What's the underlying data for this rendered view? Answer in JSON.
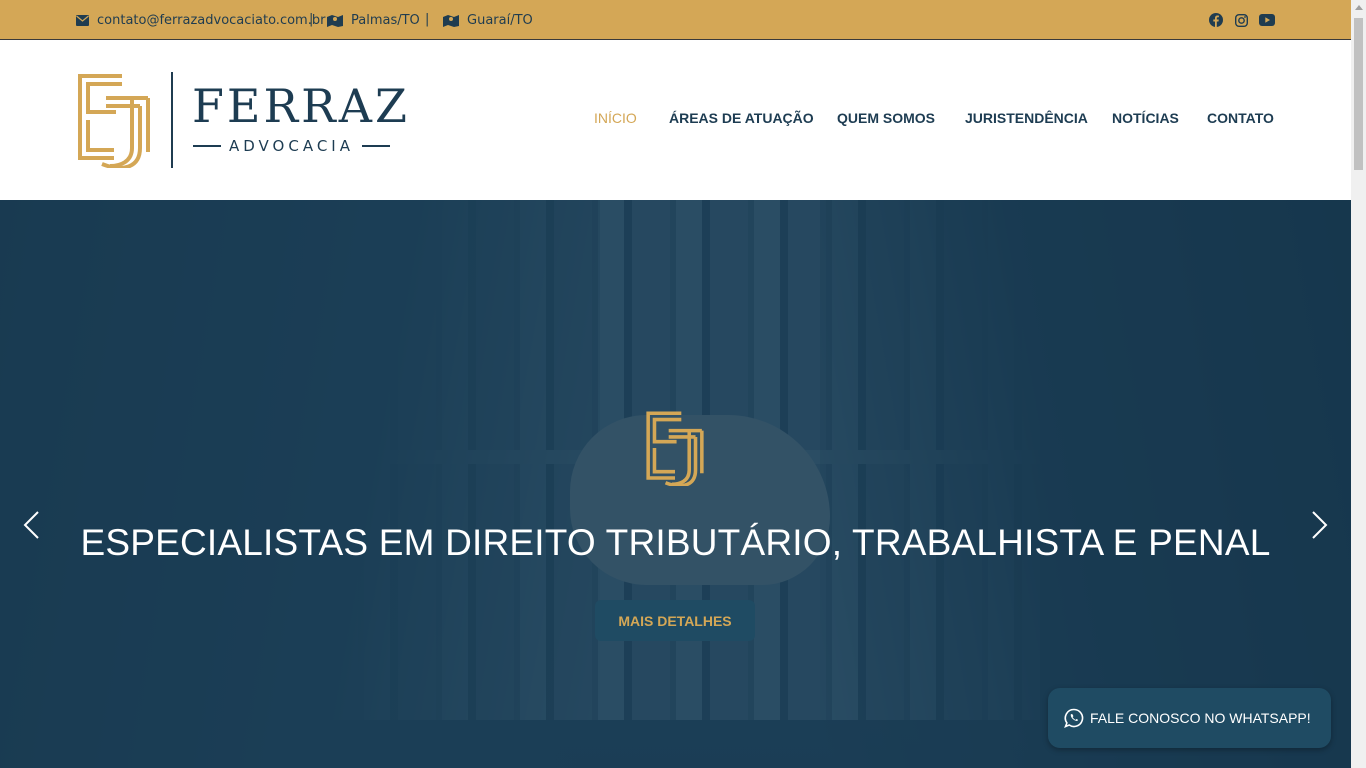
{
  "topbar": {
    "email": "contato@ferrazadvocaciato.com.br",
    "separator": "|",
    "location_1": "Palmas/TO",
    "location_2": "Guaraí/TO",
    "social_icons": [
      "facebook-icon",
      "instagram-icon",
      "youtube-icon"
    ],
    "bg_color": "#d4a756"
  },
  "header": {
    "logo_name": "FERRAZ",
    "logo_sub": "ADVOCACIA",
    "nav": [
      "INÍCIO",
      "ÁREAS DE ATUAÇÃO",
      "QUEM SOMOS",
      "JURISTENDÊNCIA",
      "NOTÍCIAS",
      "CONTATO"
    ],
    "active_nav": "INÍCIO"
  },
  "hero": {
    "title": "ESPECIALISTAS EM DIREITO TRIBUTÁRIO, TRABALHISTA E PENAL",
    "button": "MAIS DETALHES",
    "prev_icon": "chevron-left-icon",
    "next_icon": "chevron-right-icon"
  },
  "whatsapp": {
    "label": "FALE CONOSCO NO WHATSAPP!",
    "icon": "whatsapp-icon"
  },
  "colors": {
    "gold": "#d4a756",
    "navy": "#1d3c52",
    "button": "#1f4b63"
  }
}
